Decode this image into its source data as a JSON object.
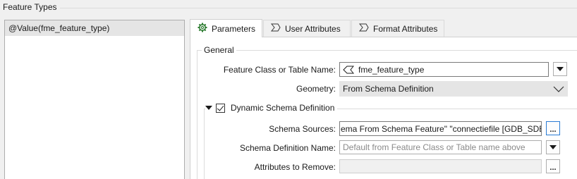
{
  "feature_types": {
    "title": "Feature Types",
    "items": [
      "@Value(fme_feature_type)"
    ]
  },
  "tabs": [
    {
      "label": "Parameters",
      "icon": "gear-icon",
      "active": true
    },
    {
      "label": "User Attributes",
      "icon": "sigma-icon",
      "active": false
    },
    {
      "label": "Format Attributes",
      "icon": "sigma-icon",
      "active": false
    }
  ],
  "general": {
    "title": "General",
    "feature_class_label": "Feature Class or Table Name:",
    "feature_class_value": "fme_feature_type",
    "geometry_label": "Geometry:",
    "geometry_value": "From Schema Definition"
  },
  "dynamic_schema": {
    "title": "Dynamic Schema Definition",
    "checked": true,
    "schema_sources_label": "Schema Sources:",
    "schema_sources_value": "ema From Schema Feature\" \"connectiefile [GDB_SDE]\"",
    "schema_def_name_label": "Schema Definition Name:",
    "schema_def_name_placeholder": "Default from Feature Class or Table name above",
    "attributes_remove_label": "Attributes to Remove:",
    "attributes_remove_value": "",
    "ellipsis": "..."
  }
}
